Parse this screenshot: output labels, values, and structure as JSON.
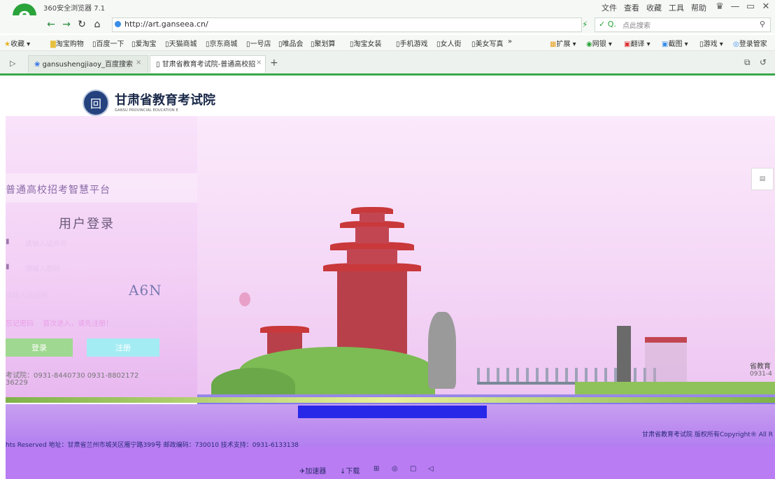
{
  "browser": {
    "app_title": "360安全浏览器 7.1",
    "menu": [
      "文件",
      "查看",
      "收藏",
      "工具",
      "帮助"
    ],
    "address": "http://art.ganseea.cn/",
    "search_placeholder": "点此搜索",
    "bookmarks": [
      "收藏",
      "淘宝购物",
      "百度一下",
      "爱淘宝",
      "天猫商城",
      "京东商城",
      "一号店",
      "唯品会",
      "聚划算",
      "淘宝女装",
      "手机游戏",
      "女人街",
      "美女写真",
      "»"
    ],
    "bookmarks_right": [
      "扩展",
      "网银",
      "翻译",
      "截图",
      "游戏",
      "登录管家"
    ],
    "tabs": [
      {
        "label": "gansushengjiaoy_百度搜索"
      },
      {
        "label": "甘肃省教育考试院-普通高校招"
      }
    ]
  },
  "header": {
    "site_name": "甘肃省教育考试院",
    "site_name_en": "GANSU PROVINCIAL EDUCATION E"
  },
  "login": {
    "platform_title": "普通高校招考智慧平台",
    "title": "用户登录",
    "username_placeholder": "请输入证件号",
    "password_placeholder": "请输入密码",
    "captcha_placeholder": "请输入验证码",
    "captcha_text": "A6N",
    "forgot_link": "忘记密码",
    "first_time_link": "首次进入，请先注册！",
    "login_button": "登录",
    "register_button": "注册",
    "phone_line1": "考试院：0931-8440730  0931-8802172",
    "phone_line2": "36229"
  },
  "footer": {
    "copyright": "甘肃省教育考试院 版权所有Copyright® All R",
    "address": "hts Reserved    地址：甘肃省兰州市城关区雁宁路399号 邮政编码：730010    技术支持：0931-6133138",
    "right_name": "省教育",
    "right_phone": "0931-4"
  },
  "statusbar": {
    "items": [
      "加速器",
      "下载"
    ]
  },
  "colors": {
    "accent_green": "#3aa84a",
    "pink_bg": "#f2cdf5",
    "footer_purple": "#b97cf2"
  }
}
